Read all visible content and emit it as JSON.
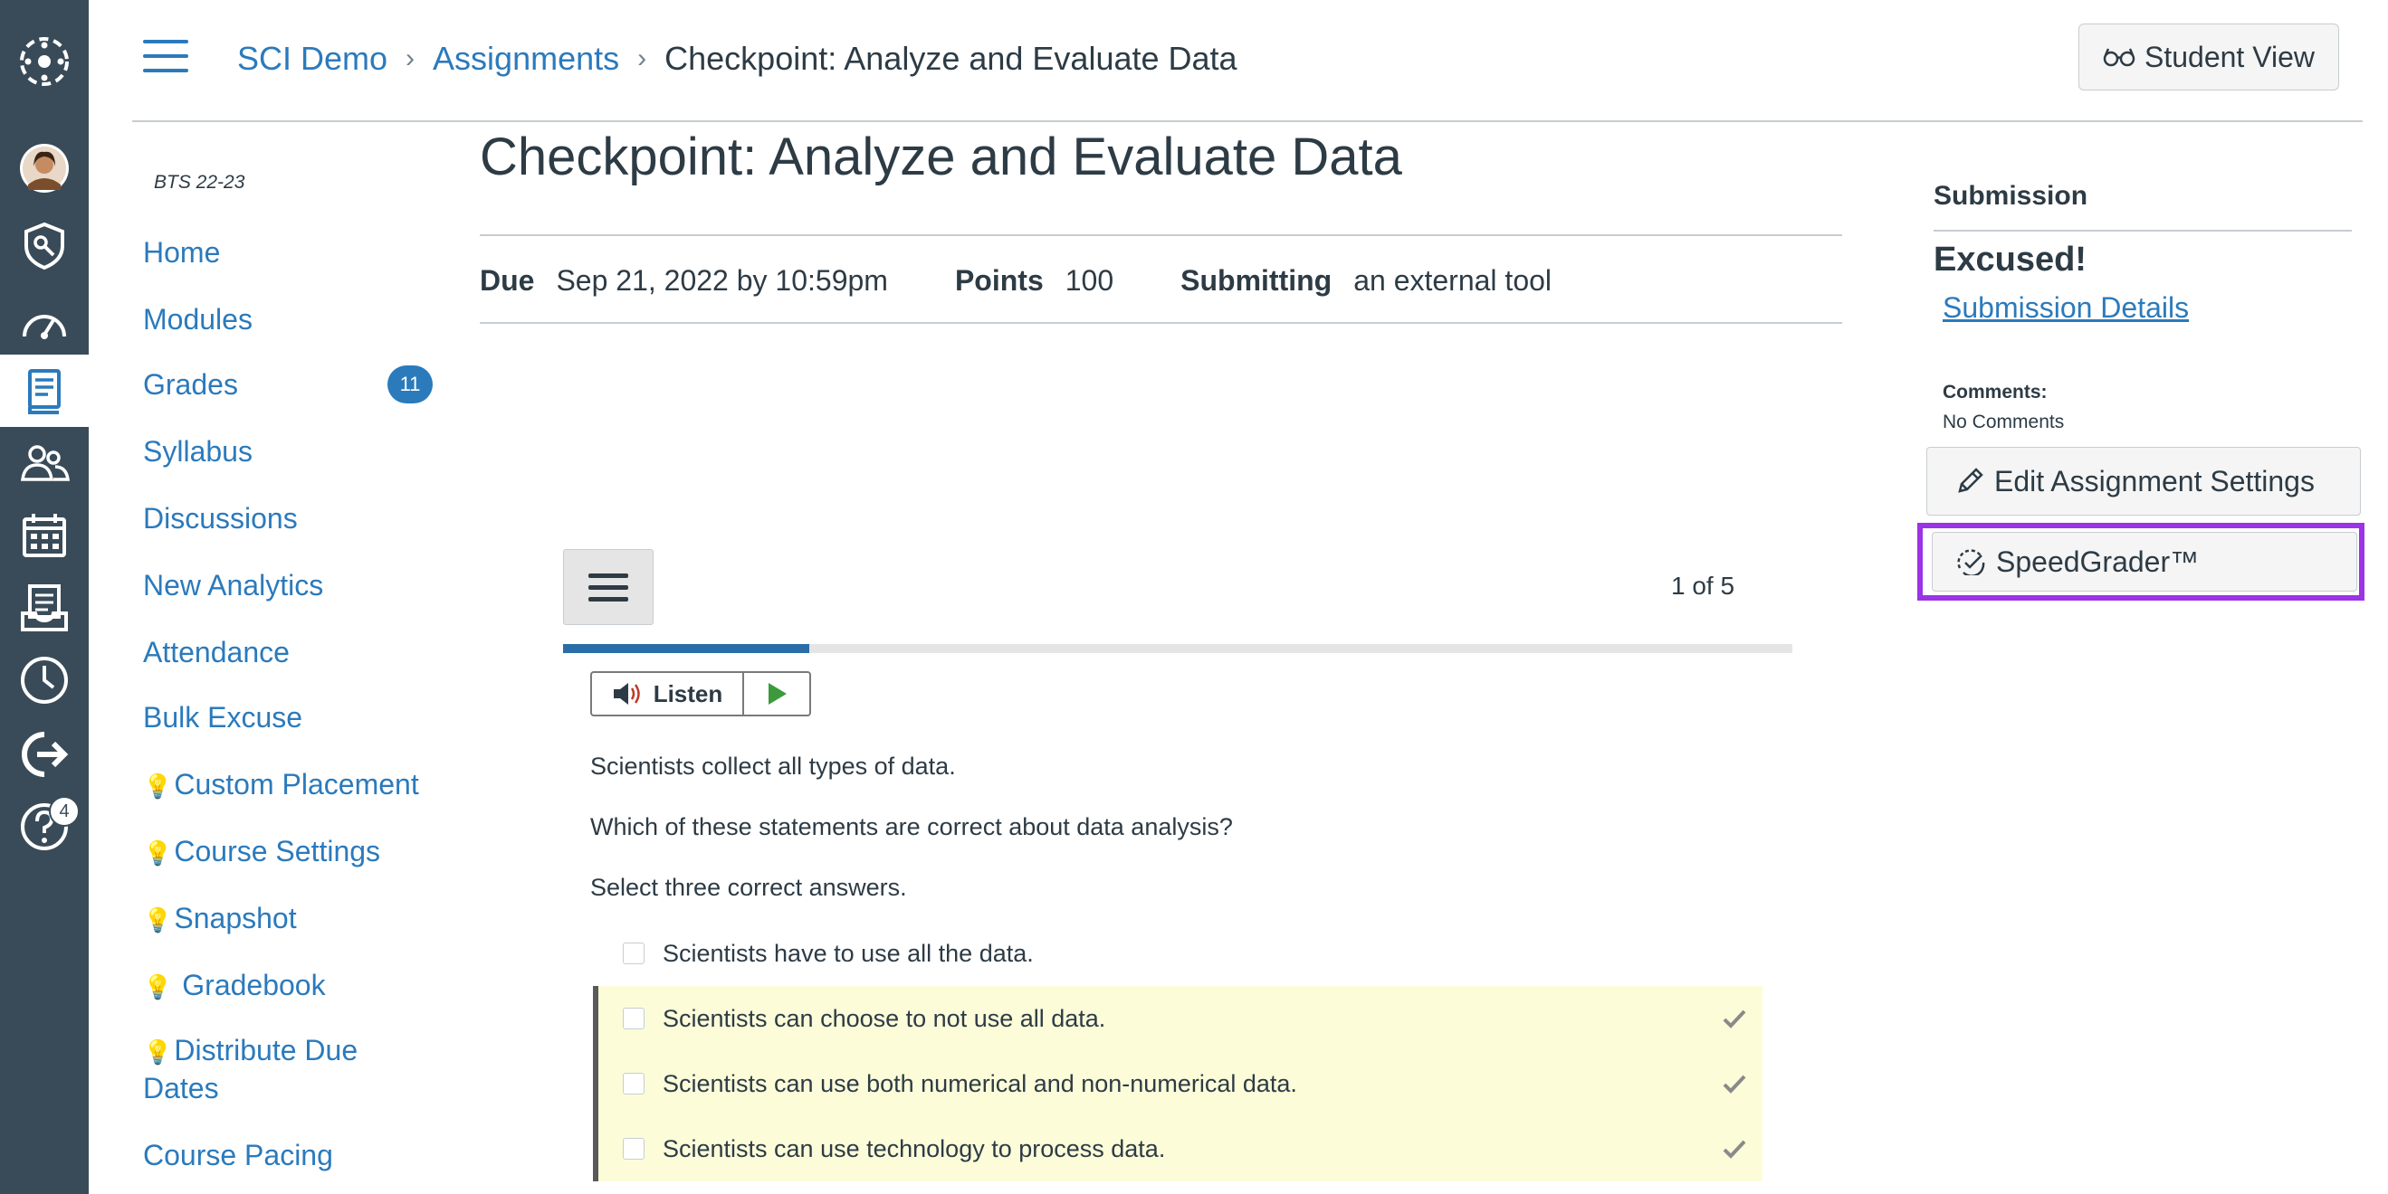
{
  "app": {
    "accent": "#2b7abc",
    "global_nav_color": "#394b58",
    "highlight_color": "#9b33e6"
  },
  "global_nav": {
    "items": [
      {
        "icon": "canvas-logo-icon"
      },
      {
        "icon": "account-avatar-icon"
      },
      {
        "icon": "admin-shield-icon"
      },
      {
        "icon": "dashboard-gauge-icon"
      },
      {
        "icon": "courses-book-icon",
        "active": true
      },
      {
        "icon": "groups-people-icon"
      },
      {
        "icon": "calendar-icon"
      },
      {
        "icon": "inbox-icon"
      },
      {
        "icon": "history-clock-icon"
      },
      {
        "icon": "commons-arrow-icon"
      },
      {
        "icon": "help-question-icon",
        "badge": "4"
      }
    ]
  },
  "breadcrumb": {
    "course": "SCI Demo",
    "section": "Assignments",
    "current": "Checkpoint: Analyze and Evaluate Data",
    "separator": "›"
  },
  "header": {
    "student_view_label": "Student View"
  },
  "course_nav": {
    "term": "BTS 22-23",
    "items": [
      {
        "label": "Home"
      },
      {
        "label": "Modules"
      },
      {
        "label": "Grades",
        "badge": "11"
      },
      {
        "label": "Syllabus"
      },
      {
        "label": "Discussions"
      },
      {
        "label": "New Analytics"
      },
      {
        "label": "Attendance"
      },
      {
        "label": "Bulk Excuse"
      },
      {
        "label": "Custom Placement",
        "bulb": true
      },
      {
        "label": "Course Settings",
        "bulb": true
      },
      {
        "label": "Snapshot",
        "bulb": true
      },
      {
        "label": " Gradebook",
        "bulb": true
      },
      {
        "label_line1": "Distribute Due",
        "label_line2": "Dates",
        "bulb": true
      },
      {
        "label": "Course Pacing"
      }
    ]
  },
  "assignment": {
    "title": "Checkpoint: Analyze and Evaluate Data",
    "due_label": "Due",
    "due_value": "Sep 21, 2022 by 10:59pm",
    "points_label": "Points",
    "points_value": "100",
    "submitting_label": "Submitting",
    "submitting_value": "an external tool"
  },
  "quiz": {
    "page_indicator": "1 of 5",
    "progress_fraction": 0.2,
    "listen_label": "Listen",
    "prompt_lines": [
      "Scientists collect all types of data.",
      "Which of these statements are correct about data analysis?",
      "Select three correct answers."
    ],
    "answers": [
      {
        "text": "Scientists have to use all the data.",
        "correct": false
      },
      {
        "text": "Scientists can choose to not use all data.",
        "correct": true
      },
      {
        "text": "Scientists can use both numerical and non-numerical data.",
        "correct": true
      },
      {
        "text": "Scientists can use technology to process data.",
        "correct": true
      }
    ]
  },
  "sidebar": {
    "heading": "Submission",
    "status": "Excused!",
    "details_link": "Submission Details",
    "comments_label": "Comments:",
    "comments_value": "No Comments",
    "edit_button": "Edit Assignment Settings",
    "speedgrader_button": "SpeedGrader™"
  }
}
